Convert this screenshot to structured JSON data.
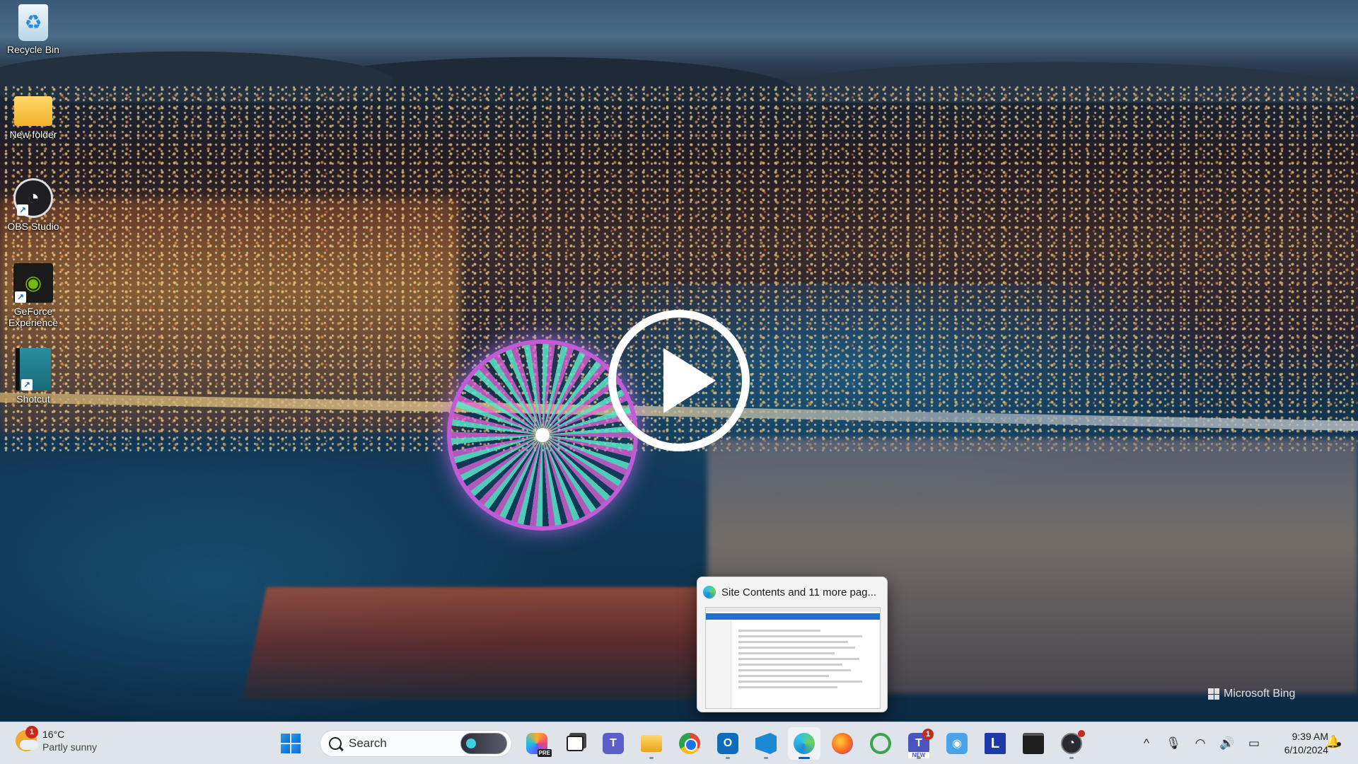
{
  "desktop": {
    "icons": [
      {
        "label": "Recycle Bin",
        "icon": "recycle-bin-icon"
      },
      {
        "label": "New folder",
        "icon": "folder-icon"
      },
      {
        "label": "OBS Studio",
        "icon": "obs-studio-icon"
      },
      {
        "label": "GeForce Experience",
        "icon": "nvidia-geforce-icon"
      },
      {
        "label": "Shotcut",
        "icon": "shotcut-icon"
      }
    ],
    "wallpaper_watermark": "Microsoft Bing"
  },
  "overlay": {
    "icon": "play-icon"
  },
  "preview": {
    "title": "Site Contents and 11 more pag...",
    "icon": "edge-icon"
  },
  "taskbar": {
    "weather": {
      "temperature": "16°C",
      "condition": "Partly sunny",
      "badge": "1"
    },
    "search": {
      "placeholder": "Search"
    },
    "apps": [
      {
        "name": "start",
        "icon": "windows-start-icon"
      },
      {
        "name": "copilot",
        "icon": "copilot-pre-icon",
        "badge_text": "PRE"
      },
      {
        "name": "task-view",
        "icon": "task-view-icon"
      },
      {
        "name": "teams",
        "icon": "teams-icon",
        "glyph": "T"
      },
      {
        "name": "file-explorer",
        "icon": "file-explorer-icon"
      },
      {
        "name": "chrome",
        "icon": "chrome-icon"
      },
      {
        "name": "outlook",
        "icon": "outlook-icon",
        "glyph": "O"
      },
      {
        "name": "vscode",
        "icon": "vscode-icon"
      },
      {
        "name": "edge",
        "icon": "edge-icon"
      },
      {
        "name": "firefox",
        "icon": "firefox-icon"
      },
      {
        "name": "qlik",
        "icon": "q-app-icon"
      },
      {
        "name": "teams-new",
        "icon": "teams-new-icon",
        "glyph": "T",
        "badge": "1",
        "badge_text": "NEW"
      },
      {
        "name": "camera",
        "icon": "camera-icon"
      },
      {
        "name": "l-app",
        "icon": "l-app-icon",
        "glyph": "L"
      },
      {
        "name": "terminal",
        "icon": "terminal-icon"
      },
      {
        "name": "obs",
        "icon": "obs-studio-icon"
      }
    ],
    "tray": {
      "overflow": "^",
      "icons": [
        "microphone-icon",
        "wifi-icon",
        "volume-icon",
        "battery-icon"
      ]
    },
    "clock": {
      "time": "9:39 AM",
      "date": "6/10/2024"
    },
    "notifications_icon": "bell-icon"
  },
  "colors": {
    "taskbar_bg": "#dfe3ea",
    "accent": "#0a5fb8",
    "badge": "#c42b1c"
  }
}
